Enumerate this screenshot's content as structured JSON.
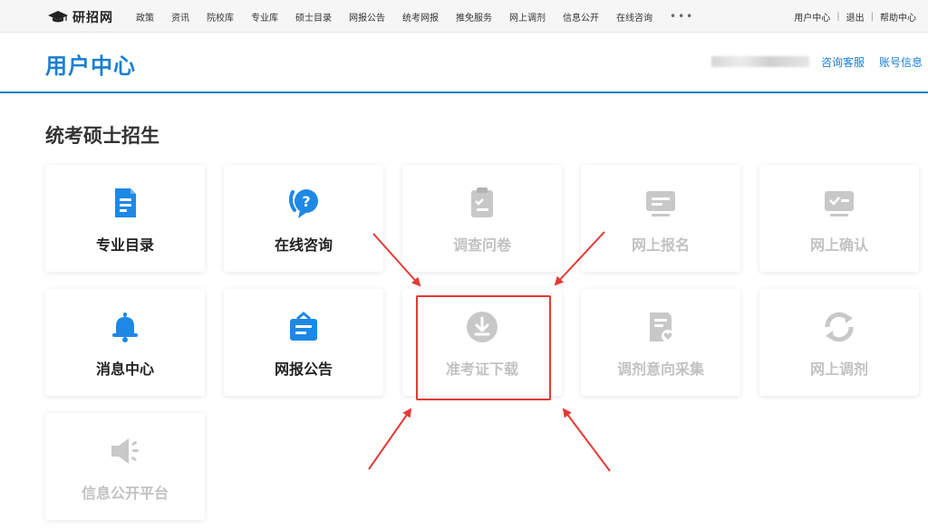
{
  "topnav": {
    "logo_text": "研招网",
    "links": [
      "政策",
      "资讯",
      "院校库",
      "专业库",
      "硕士目录",
      "网报公告",
      "统考网报",
      "推免服务",
      "网上调剂",
      "信息公开",
      "在线咨询"
    ],
    "more": "•••",
    "tools": [
      "用户中心",
      "退出",
      "帮助中心"
    ],
    "tool_separator": "|"
  },
  "header": {
    "title": "用户中心",
    "links": [
      "咨询客服",
      "账号信息"
    ]
  },
  "section": {
    "title": "统考硕士招生",
    "tiles": [
      {
        "label": "专业目录",
        "icon": "document-icon",
        "enabled": true
      },
      {
        "label": "在线咨询",
        "icon": "chat-question-icon",
        "enabled": true
      },
      {
        "label": "调查问卷",
        "icon": "clipboard-icon",
        "enabled": false
      },
      {
        "label": "网上报名",
        "icon": "monitor-form-icon",
        "enabled": false
      },
      {
        "label": "网上确认",
        "icon": "monitor-check-icon",
        "enabled": false
      },
      {
        "label": "消息中心",
        "icon": "bell-icon",
        "enabled": true
      },
      {
        "label": "网报公告",
        "icon": "notice-board-icon",
        "enabled": true
      },
      {
        "label": "准考证下载",
        "icon": "download-icon",
        "enabled": false,
        "highlighted": true
      },
      {
        "label": "调剂意向采集",
        "icon": "document-heart-icon",
        "enabled": false
      },
      {
        "label": "网上调剂",
        "icon": "refresh-icon",
        "enabled": false
      },
      {
        "label": "信息公开平台",
        "icon": "speaker-icon",
        "enabled": false
      }
    ]
  },
  "colors": {
    "brand": "#1a7fd1",
    "icon_active": "#1e88e5",
    "icon_disabled": "#c8c8c8",
    "highlight": "#e53935"
  }
}
